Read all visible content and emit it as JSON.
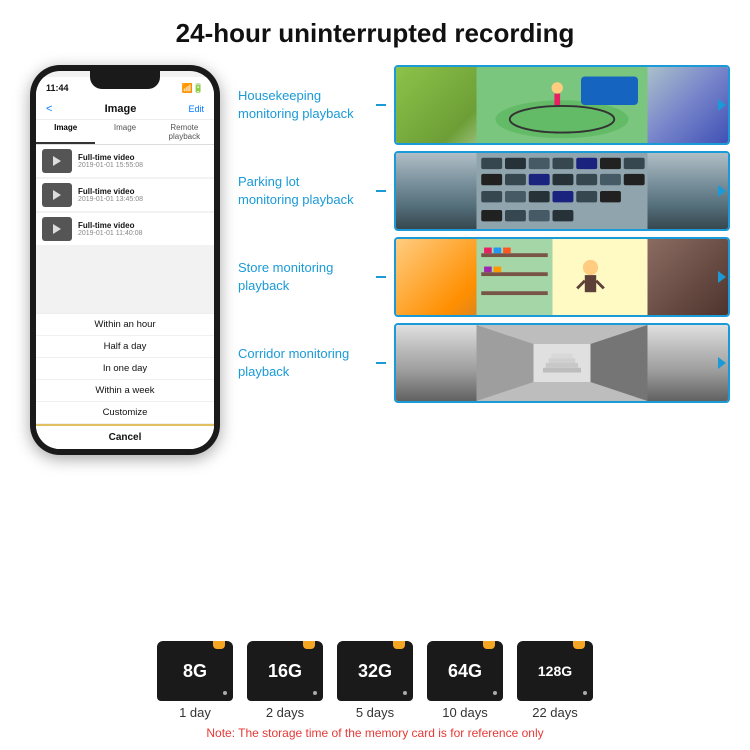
{
  "header": {
    "title": "24-hour uninterrupted recording"
  },
  "phone": {
    "time": "11:44",
    "screen_title": "Image",
    "edit_btn": "Edit",
    "back_btn": "<",
    "tabs": [
      "Image",
      "Image",
      "Remote playback"
    ],
    "videos": [
      {
        "title": "Full-time video",
        "date": "2019-01-01 15:55:08"
      },
      {
        "title": "Full-time video",
        "date": "2019-01-01 13:45:08"
      },
      {
        "title": "Full-time video",
        "date": "2019-01-01 11:40:08"
      }
    ],
    "dropdown_items": [
      "Within an hour",
      "Half a day",
      "In one day",
      "Within a week",
      "Customize"
    ],
    "cancel_btn": "Cancel"
  },
  "monitoring": [
    {
      "label": "Housekeeping\nmonitoring playback",
      "img_class": "img-housekeeping"
    },
    {
      "label": "Parking lot\nmonitoring playback",
      "img_class": "img-parking"
    },
    {
      "label": "Store monitoring\nplayback",
      "img_class": "img-store"
    },
    {
      "label": "Corridor monitoring\nplayback",
      "img_class": "img-corridor"
    }
  ],
  "storage": [
    {
      "size": "8G",
      "days": "1 day"
    },
    {
      "size": "16G",
      "days": "2 days"
    },
    {
      "size": "32G",
      "days": "5 days"
    },
    {
      "size": "64G",
      "days": "10 days"
    },
    {
      "size": "128G",
      "days": "22 days"
    }
  ],
  "note": "Note: The storage time of the memory card is for reference only"
}
